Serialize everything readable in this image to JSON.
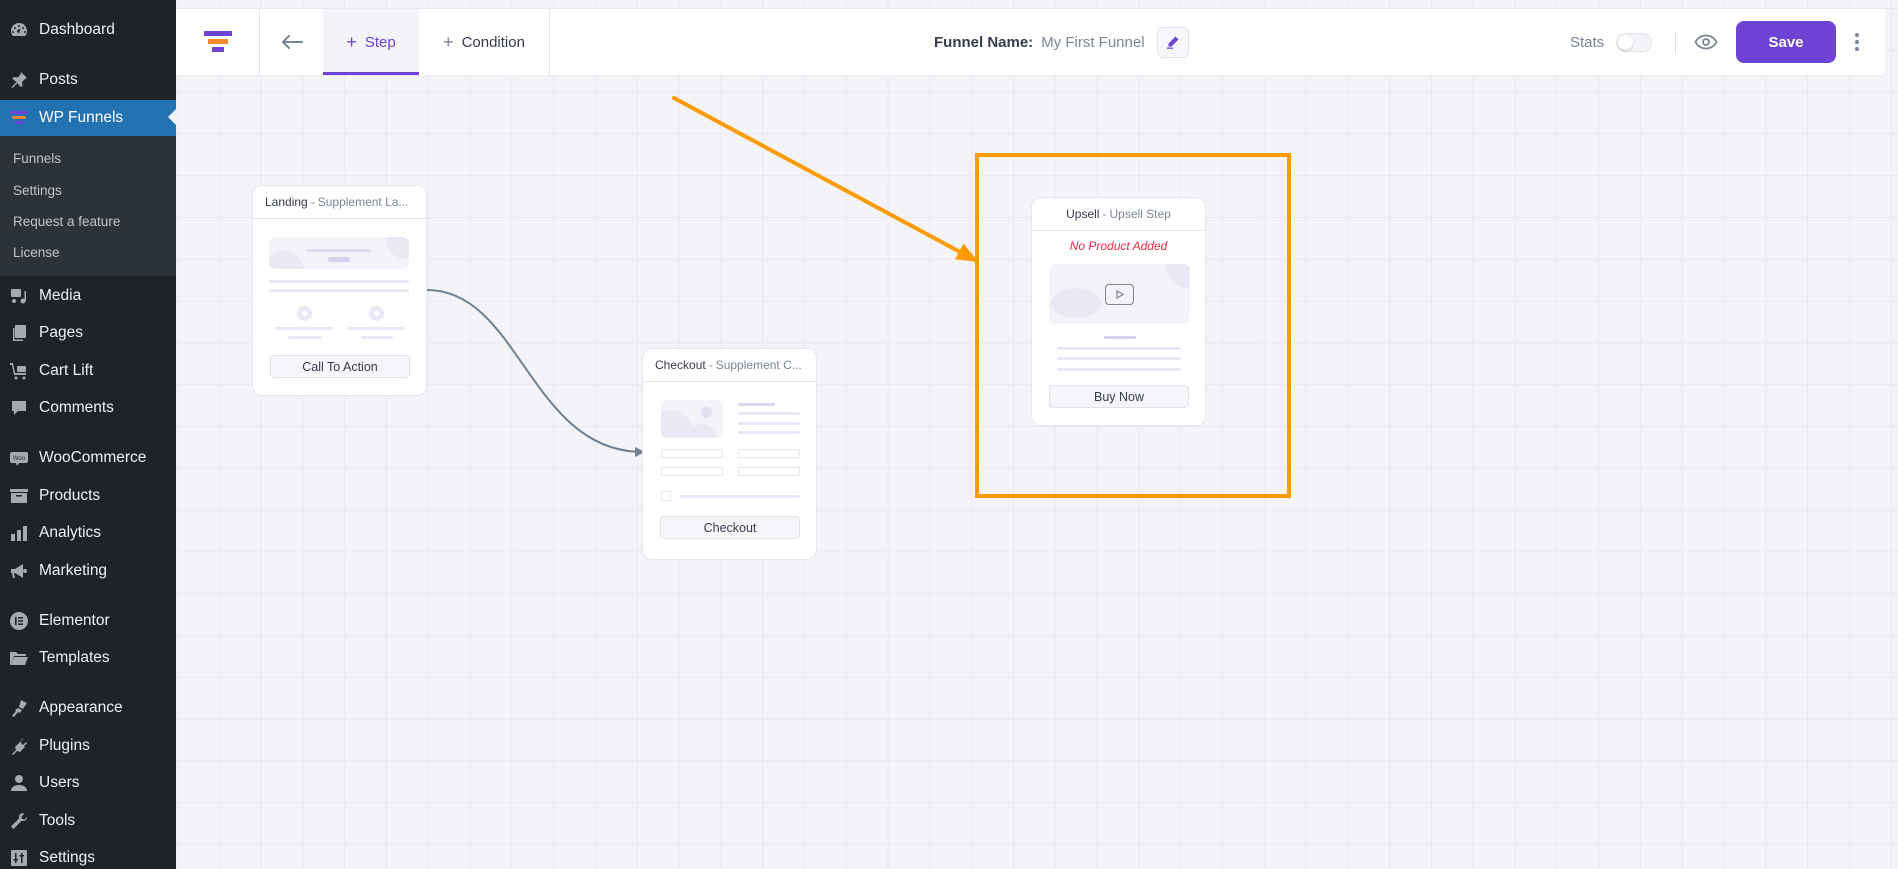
{
  "sidebar": {
    "items": [
      {
        "label": "Dashboard",
        "icon": "dashboard-icon"
      },
      {
        "label": "Posts",
        "icon": "pin-icon"
      },
      {
        "label": "WP Funnels",
        "icon": "funnel-icon",
        "active": true
      },
      {
        "label": "Media",
        "icon": "media-icon"
      },
      {
        "label": "Pages",
        "icon": "pages-icon"
      },
      {
        "label": "Cart Lift",
        "icon": "cart-icon"
      },
      {
        "label": "Comments",
        "icon": "comment-icon"
      },
      {
        "label": "WooCommerce",
        "icon": "woo-icon"
      },
      {
        "label": "Products",
        "icon": "archive-icon"
      },
      {
        "label": "Analytics",
        "icon": "bar-chart-icon"
      },
      {
        "label": "Marketing",
        "icon": "megaphone-icon"
      },
      {
        "label": "Elementor",
        "icon": "elementor-icon"
      },
      {
        "label": "Templates",
        "icon": "folder-icon"
      },
      {
        "label": "Appearance",
        "icon": "brush-icon"
      },
      {
        "label": "Plugins",
        "icon": "plug-icon"
      },
      {
        "label": "Users",
        "icon": "user-icon"
      },
      {
        "label": "Tools",
        "icon": "wrench-icon"
      },
      {
        "label": "Settings",
        "icon": "sliders-icon"
      }
    ],
    "submenu": [
      "Funnels",
      "Settings",
      "Request a feature",
      "License"
    ]
  },
  "header": {
    "tabs": [
      {
        "label": "Step",
        "active": true
      },
      {
        "label": "Condition",
        "active": false
      }
    ],
    "funnel_name_label": "Funnel Name:",
    "funnel_name_value": "My First Funnel",
    "stats_label": "Stats",
    "stats_enabled": false,
    "save_label": "Save"
  },
  "cards": {
    "landing": {
      "type": "Landing",
      "name": "Supplement La...",
      "button": "Call To Action"
    },
    "checkout": {
      "type": "Checkout",
      "name": "Supplement C...",
      "button": "Checkout"
    },
    "upsell": {
      "type": "Upsell",
      "name": "Upsell Step",
      "warning": "No Product Added",
      "button": "Buy Now"
    }
  },
  "separator": "-",
  "colors": {
    "brand_purple": "#6e42d3",
    "brand_orange": "#f7882f",
    "wp_sidebar": "#1d2327",
    "wp_active": "#2271b1",
    "annotation_orange": "#ff9a00",
    "warning_red": "#ee2a4a",
    "connector": "#728191"
  }
}
